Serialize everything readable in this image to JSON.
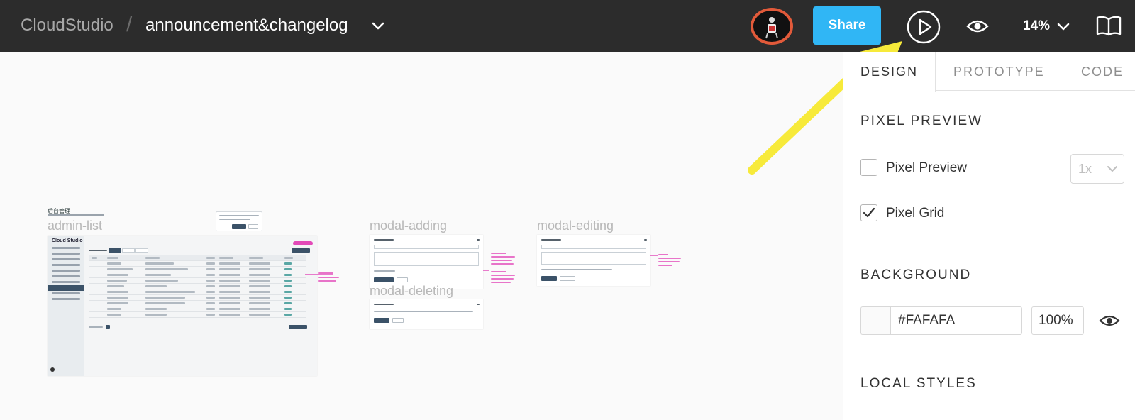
{
  "topbar": {
    "project_name": "CloudStudio",
    "separator": "/",
    "file_name": "announcement&changelog",
    "share_label": "Share",
    "zoom_label": "14%"
  },
  "panel": {
    "tabs": [
      {
        "label": "DESIGN",
        "active": true
      },
      {
        "label": "PROTOTYPE",
        "active": false
      },
      {
        "label": "CODE",
        "active": false
      }
    ],
    "pixel_preview_title": "PIXEL PREVIEW",
    "pixel_preview_label": "Pixel Preview",
    "pixel_preview_checked": false,
    "pixel_preview_scale": "1x",
    "pixel_grid_label": "Pixel Grid",
    "pixel_grid_checked": true,
    "background_title": "BACKGROUND",
    "background_hex": "#FAFAFA",
    "background_opacity": "100%",
    "local_styles_title": "LOCAL STYLES"
  },
  "canvas": {
    "frames": [
      {
        "label": "admin-list"
      },
      {
        "label": "modal-adding"
      },
      {
        "label": "modal-editing"
      },
      {
        "label": "modal-deleting"
      }
    ],
    "admin_list": {
      "brand": "Cloud Studio",
      "heading": "后台管理"
    }
  },
  "colors": {
    "topbar_bg": "#2c2c2c",
    "share_blue": "#30b6f5",
    "avatar_ring": "#e25a3a",
    "annotation_arrow": "#f7ea3a",
    "annotation_pink": "#e45cc0",
    "canvas_bg": "#FAFAFA"
  },
  "icons": {
    "file_menu": "chevron-down-icon",
    "present": "play-icon",
    "view": "eye-icon",
    "zoom_menu": "chevron-down-icon",
    "docs": "book-icon"
  }
}
